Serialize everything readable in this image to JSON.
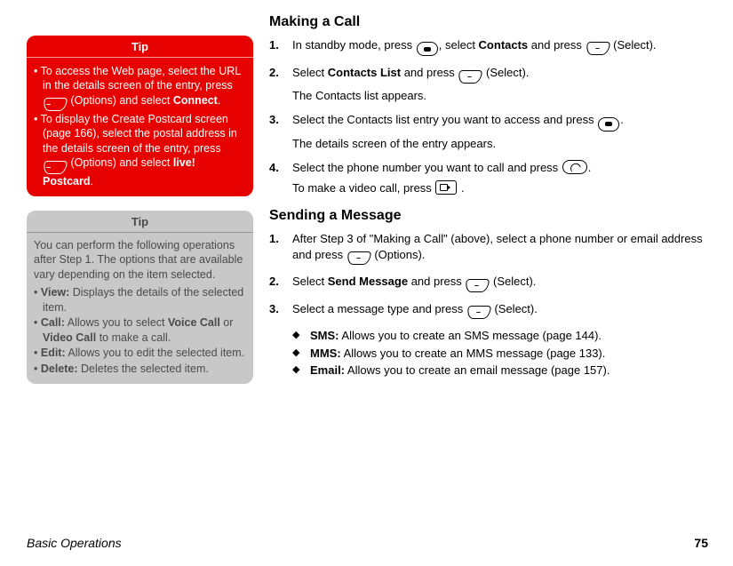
{
  "footer": {
    "section": "Basic Operations",
    "page": "75"
  },
  "tip1": {
    "header": "Tip",
    "items": [
      {
        "pre": "To access the Web page, select the URL in the details screen of the entry, press ",
        "softkey": "–",
        "mid": " (Options) and select ",
        "bold": "Connect",
        "post": "."
      },
      {
        "pre": "To display the Create Postcard screen (page 166), select the postal address in the details screen of the entry, press ",
        "softkey": "–",
        "mid": " (Options) and select ",
        "bold": "live! Postcard",
        "post": "."
      }
    ]
  },
  "tip2": {
    "header": "Tip",
    "intro": "You can perform the following operations after Step 1. The options that are available vary depending on the item selected.",
    "items": [
      {
        "label": "View:",
        "text": " Displays the details of the selected item."
      },
      {
        "label": "Call:",
        "text_pre": " Allows you to select ",
        "b1": "Voice Call",
        "or": " or ",
        "b2": "Video Call",
        "text_post": " to make a call."
      },
      {
        "label": "Edit:",
        "text": " Allows you to edit the selected item."
      },
      {
        "label": "Delete:",
        "text": " Deletes the selected item."
      }
    ]
  },
  "section1": {
    "heading": "Making a Call",
    "step1": {
      "a": "In standby mode, press ",
      "b": ", select ",
      "bold": "Contacts",
      "c": " and press ",
      "soft": "–",
      "d": " (Select)."
    },
    "step2": {
      "a": "Select ",
      "bold": "Contacts List",
      "b": " and press ",
      "soft": "–",
      "c": " (Select).",
      "sub": "The Contacts list appears."
    },
    "step3": {
      "a": "Select the Contacts list entry you want to access and press ",
      "b": ".",
      "sub": "The details screen of the entry appears."
    },
    "step4": {
      "a": "Select the phone number you want to call and press ",
      "b": ".",
      "sub_a": "To make a video call, press ",
      "sub_b": " ."
    }
  },
  "section2": {
    "heading": "Sending a Message",
    "step1": {
      "a": "After Step 3 of \"Making a Call\" (above), select a phone number or email address and press ",
      "soft": "–",
      "b": " (Options)."
    },
    "step2": {
      "a": "Select ",
      "bold": "Send Message",
      "b": " and press ",
      "soft": "–",
      "c": " (Select)."
    },
    "step3": {
      "a": "Select a message type and press ",
      "soft": "–",
      "b": " (Select)."
    },
    "types": [
      {
        "label": "SMS:",
        "text": " Allows you to create an SMS message (page 144)."
      },
      {
        "label": "MMS:",
        "text": " Allows you to create an MMS message (page 133)."
      },
      {
        "label": "Email:",
        "text": " Allows you to create an email message (page 157)."
      }
    ]
  }
}
